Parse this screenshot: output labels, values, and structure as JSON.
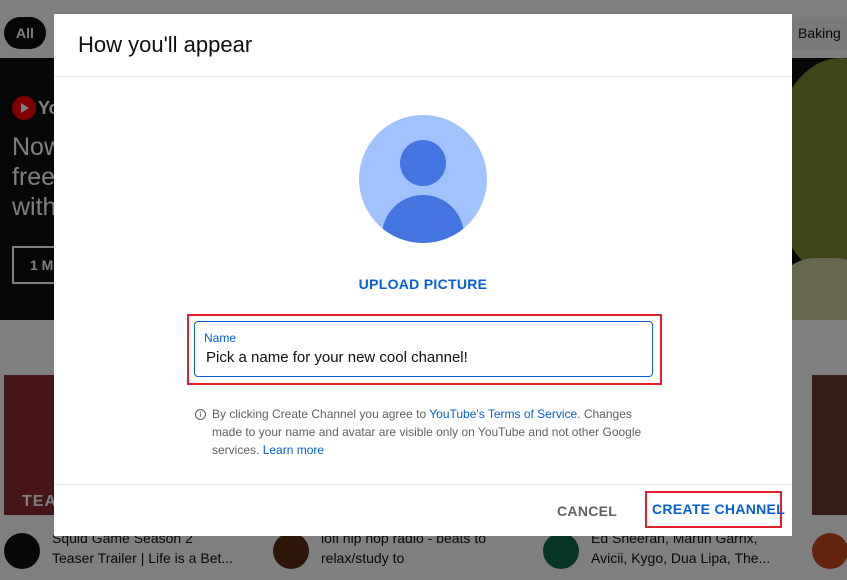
{
  "background": {
    "chips": {
      "all": "All",
      "baking": "Baking"
    },
    "banner": {
      "logo_text": "Yo",
      "line1": "Now",
      "line2": "free",
      "line3": "with",
      "trial_button": "1 M"
    },
    "thumb_label": "TEA",
    "videos": [
      {
        "line1": "Squid Game Season 2",
        "line2": "Teaser Trailer | Life is a Bet..."
      },
      {
        "line1": "lofi hip hop radio - beats to",
        "line2": "relax/study to"
      },
      {
        "line1": "Ed Sheeran, Martin Garrix,",
        "line2": "Avicii, Kygo, Dua Lipa, The..."
      }
    ]
  },
  "dialog": {
    "title": "How you'll appear",
    "upload_label": "UPLOAD PICTURE",
    "name_field": {
      "label": "Name",
      "value": "Pick a name for your new cool channel!"
    },
    "info": {
      "prefix": "By clicking Create Channel you agree to ",
      "tos_link": "YouTube's Terms of Service",
      "middle": ". Changes made to your name and avatar are visible only on YouTube and not other Google services. ",
      "learn_more": "Learn more"
    },
    "cancel_label": "CANCEL",
    "create_label": "CREATE CHANNEL"
  },
  "colors": {
    "accent_blue": "#065fd4",
    "highlight_red": "#e0202b",
    "avatar_light": "#a0c3ff",
    "avatar_dark": "#4374e0"
  },
  "icons": {
    "info": "info-circle-icon",
    "avatar": "default-avatar-icon"
  }
}
